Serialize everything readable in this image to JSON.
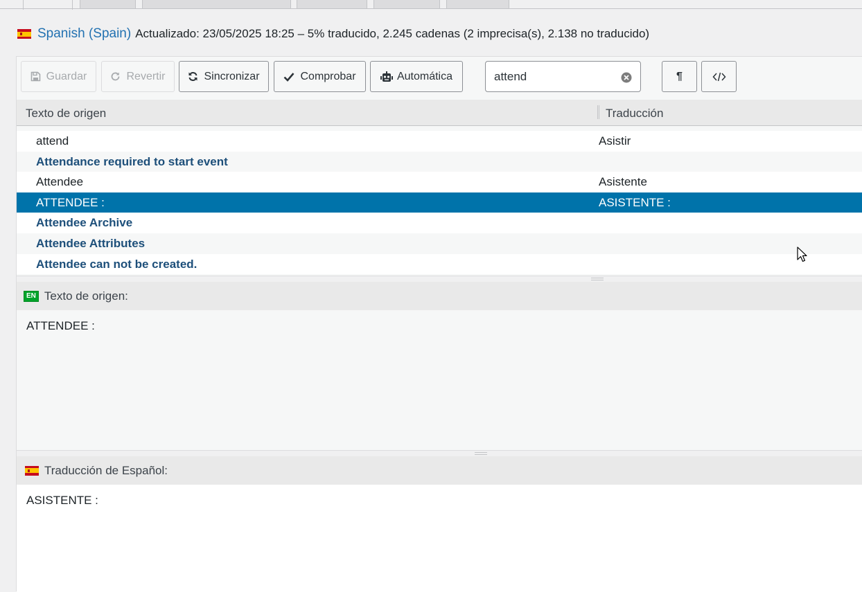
{
  "header": {
    "language": "Spanish (Spain)",
    "meta": "Actualizado: 23/05/2025 18:25 – 5% traducido, 2.245 cadenas (2 imprecisa(s), 2.138 no traducido)"
  },
  "toolbar": {
    "save_label": "Guardar",
    "revert_label": "Revertir",
    "sync_label": "Sincronizar",
    "check_label": "Comprobar",
    "auto_label": "Automática",
    "search_value": "attend",
    "invisibles_label": "¶"
  },
  "list": {
    "col_source": "Texto de origen",
    "col_translation": "Traducción",
    "rows": [
      {
        "source": "attend",
        "translation": "Asistir"
      },
      {
        "source": "Attendance required to start event",
        "translation": ""
      },
      {
        "source": "Attendee",
        "translation": "Asistente"
      },
      {
        "source": "ATTENDEE :",
        "translation": "ASISTENTE :"
      },
      {
        "source": "Attendee Archive",
        "translation": ""
      },
      {
        "source": "Attendee Attributes",
        "translation": ""
      },
      {
        "source": "Attendee can not be created.",
        "translation": ""
      }
    ]
  },
  "source_pane": {
    "badge": "EN",
    "title": "Texto de origen:",
    "text": "ATTENDEE :"
  },
  "translation_pane": {
    "title": "Traducción de Español:",
    "text": "ASISTENTE :"
  },
  "colors": {
    "accent": "#0073aa",
    "link": "#2271b1",
    "untranslated_text": "#1d4f7a",
    "en_badge": "#00a32a"
  }
}
